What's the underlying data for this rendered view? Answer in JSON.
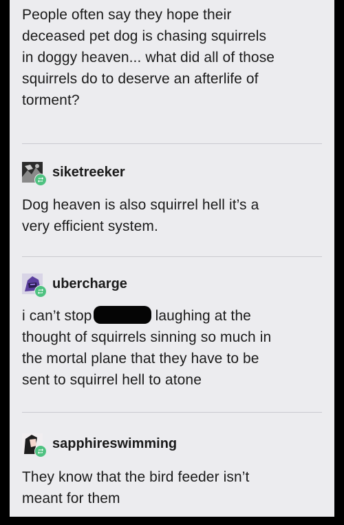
{
  "original_post": {
    "lines": [
      "People often say they hope their",
      "deceased pet dog is chasing squirrels",
      "in doggy heaven... what did all of those",
      "squirrels do to deserve an afterlife of",
      "torment?"
    ]
  },
  "reblogs": [
    {
      "username": "siketreeker",
      "avatar_icon": "dark-photo-avatar-icon",
      "lines": [
        "Dog heaven is also squirrel hell it’s a",
        "very efficient system."
      ]
    },
    {
      "username": "ubercharge",
      "avatar_icon": "purple-helmet-avatar-icon",
      "line1_before": "i can’t stop",
      "line1_after": "laughing at the",
      "lines_rest": [
        "thought of squirrels sinning so much in",
        "the mortal plane that they have to be",
        "sent to squirrel hell to atone"
      ]
    },
    {
      "username": "sapphireswimming",
      "avatar_icon": "anime-character-avatar-icon",
      "lines": [
        "They know that the bird feeder isn’t",
        "meant for them"
      ]
    }
  ],
  "colors": {
    "card_background": "#ececef",
    "frame": "#000000",
    "reblog_badge": "#4fc281",
    "text": "#1a1a1a"
  }
}
